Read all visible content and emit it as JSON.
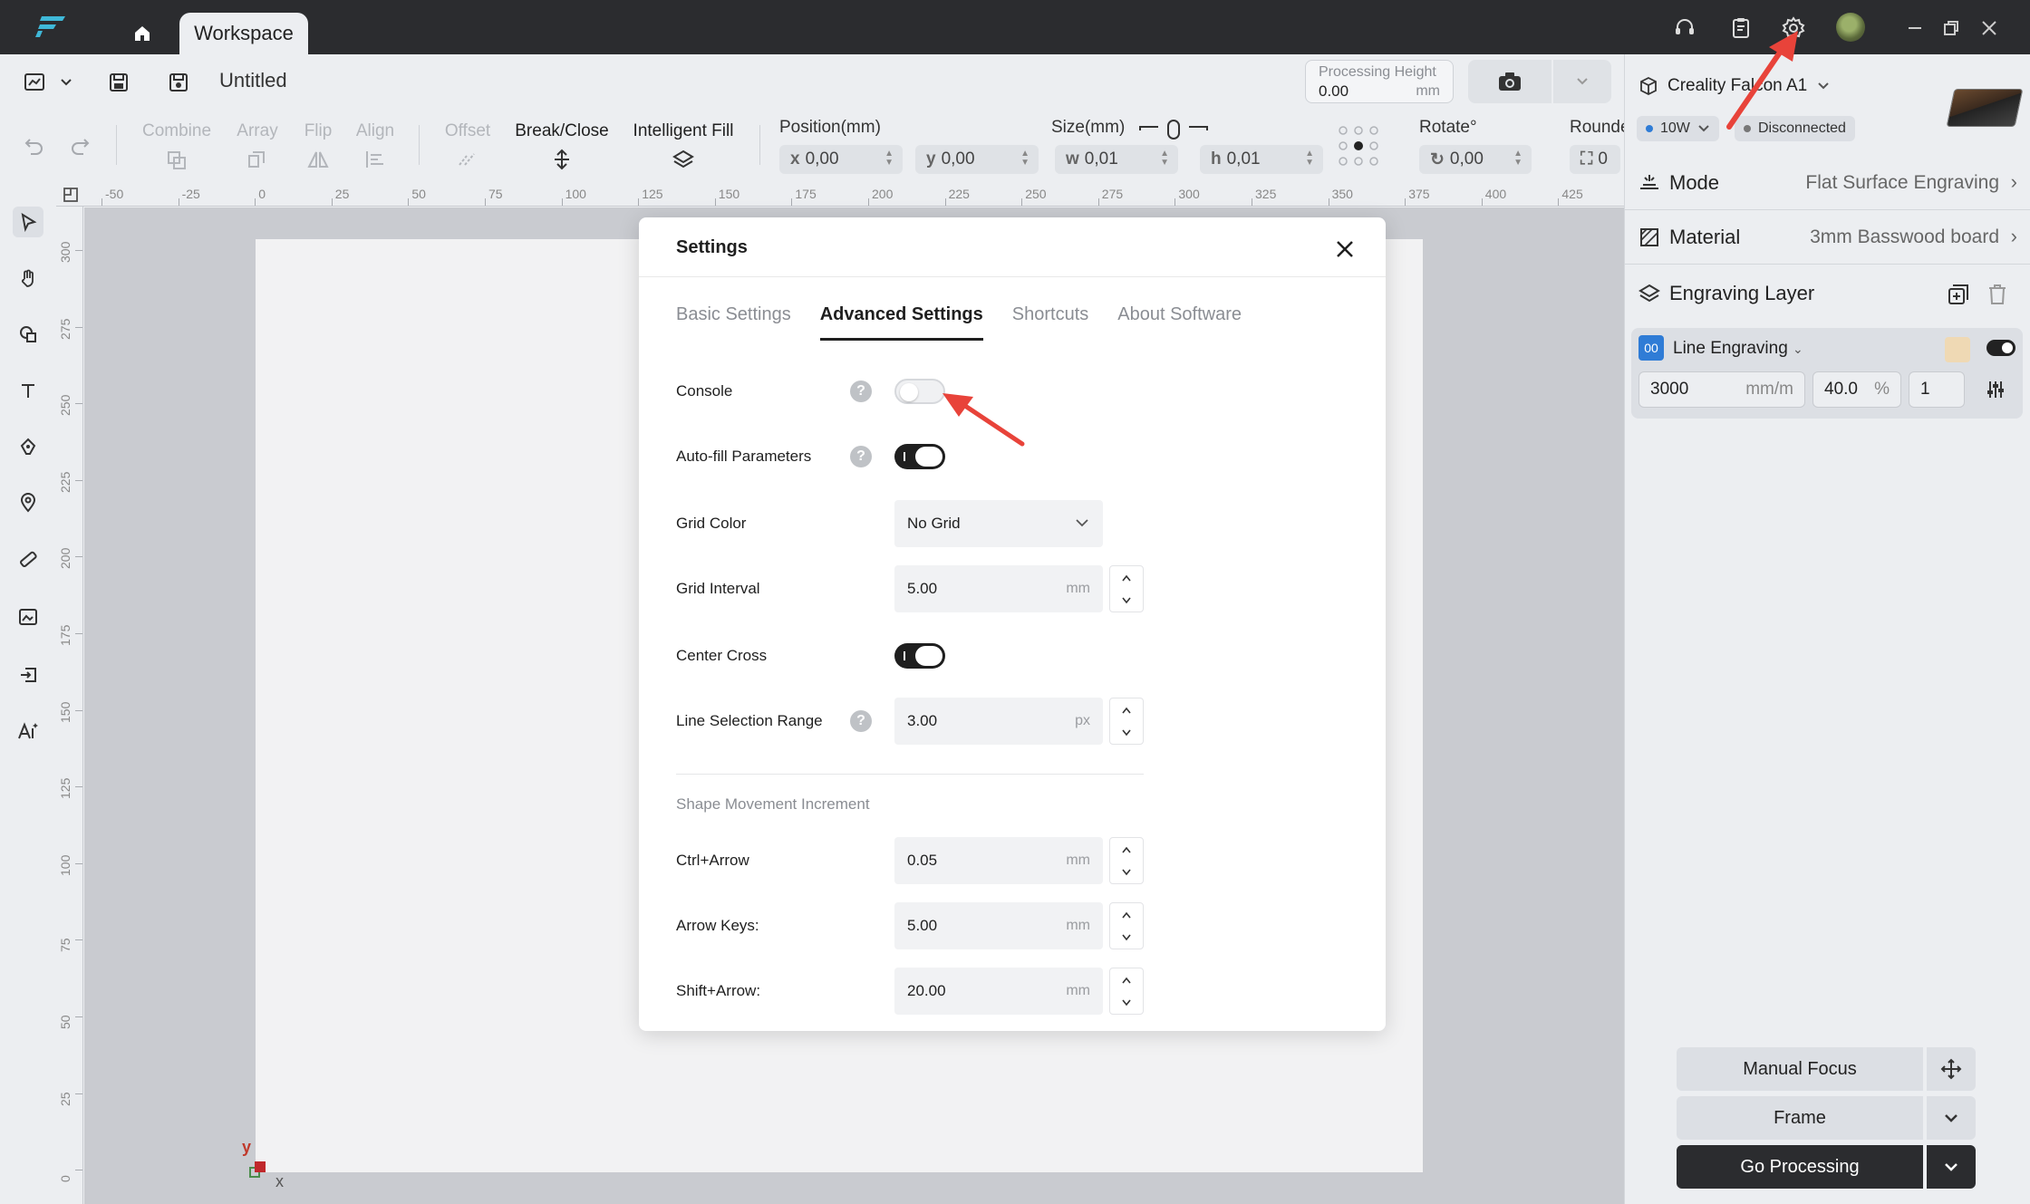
{
  "titlebar": {
    "tab_label": "Workspace",
    "icons": [
      "support-icon",
      "clipboard-icon",
      "settings-gear-icon",
      "minimize-icon",
      "restore-icon",
      "close-icon"
    ]
  },
  "toolbar": {
    "doc_title": "Untitled",
    "processing_height": {
      "label": "Processing Height",
      "value": "0.00",
      "unit": "mm"
    },
    "tools": {
      "combine": "Combine",
      "array": "Array",
      "flip": "Flip",
      "align": "Align",
      "offset": "Offset",
      "break_close": "Break/Close",
      "intelligent_fill": "Intelligent Fill"
    },
    "position": {
      "label": "Position(mm)",
      "x_prefix": "x",
      "x": "0,00",
      "y_prefix": "y",
      "y": "0,00"
    },
    "size": {
      "label": "Size(mm)",
      "w_prefix": "w",
      "w": "0,01",
      "h_prefix": "h",
      "h": "0,01"
    },
    "rotate": {
      "label": "Rotate°",
      "value": "0,00"
    },
    "round": {
      "label": "Rounde",
      "value": "0"
    }
  },
  "rulers": {
    "top": [
      "-50",
      "-25",
      "0",
      "25",
      "50",
      "75",
      "100",
      "125",
      "150",
      "175",
      "200",
      "225",
      "250",
      "275",
      "300",
      "325",
      "350",
      "375",
      "400",
      "425"
    ],
    "left": [
      "300",
      "275",
      "250",
      "225",
      "200",
      "175",
      "150",
      "125",
      "100",
      "75",
      "50",
      "25",
      "0"
    ]
  },
  "canvas": {
    "axis_y": "y",
    "axis_x": "x"
  },
  "right_panel": {
    "machine": "Creality Falcon A1",
    "power": "10W",
    "status": "Disconnected",
    "mode": {
      "label": "Mode",
      "value": "Flat Surface Engraving"
    },
    "material": {
      "label": "Material",
      "value": "3mm Basswood board"
    },
    "layer_title": "Engraving Layer",
    "layer": {
      "badge": "00",
      "name": "Line Engraving",
      "speed": "3000",
      "speed_unit": "mm/m",
      "power": "40.0",
      "power_unit": "%",
      "passes": "1"
    },
    "buttons": {
      "manual_focus": "Manual Focus",
      "frame": "Frame",
      "go_processing": "Go Processing"
    }
  },
  "modal": {
    "title": "Settings",
    "tabs": [
      "Basic Settings",
      "Advanced Settings",
      "Shortcuts",
      "About Software"
    ],
    "active_tab": "Advanced Settings",
    "settings": {
      "console": {
        "label": "Console",
        "enabled": false
      },
      "autofill": {
        "label": "Auto-fill Parameters",
        "enabled": true
      },
      "grid_color": {
        "label": "Grid Color",
        "value": "No Grid"
      },
      "grid_interval": {
        "label": "Grid Interval",
        "value": "5.00",
        "unit": "mm"
      },
      "center_cross": {
        "label": "Center Cross",
        "enabled": true
      },
      "line_selection": {
        "label": "Line Selection Range",
        "value": "3.00",
        "unit": "px"
      }
    },
    "increment_section": "Shape Movement Increment",
    "increments": {
      "ctrl_arrow": {
        "label": "Ctrl+Arrow",
        "value": "0.05",
        "unit": "mm"
      },
      "arrow_keys": {
        "label": "Arrow Keys:",
        "value": "5.00",
        "unit": "mm"
      },
      "shift_arrow": {
        "label": "Shift+Arrow:",
        "value": "20.00",
        "unit": "mm"
      }
    },
    "help_glyph": "?"
  },
  "colors": {
    "accent": "#2f7cd6",
    "annotation": "#e8433a",
    "dark": "#2b2c2f"
  }
}
